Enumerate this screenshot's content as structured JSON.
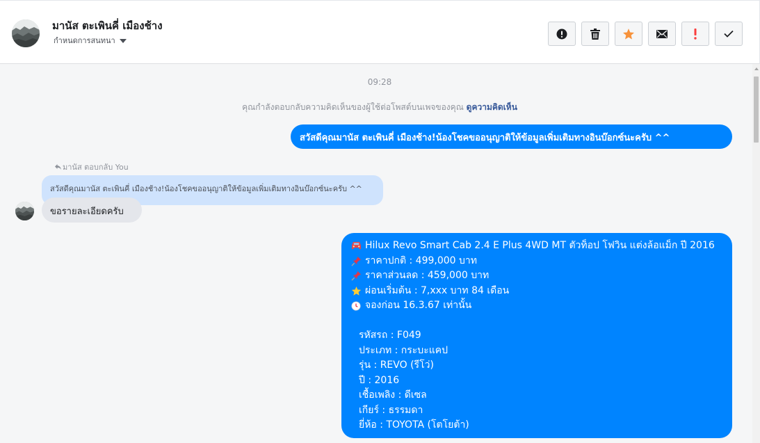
{
  "header": {
    "contact_name": "มานัส ตะเพินคี่ เมืองช้าง",
    "assign_label": "กำหนดการสนทนา",
    "actions": [
      {
        "name": "report-spam-button",
        "icon": "exclamation-circle-icon"
      },
      {
        "name": "delete-button",
        "icon": "trash-icon"
      },
      {
        "name": "star-button",
        "icon": "star-icon",
        "color": "#f7923b"
      },
      {
        "name": "mark-unread-button",
        "icon": "envelope-icon"
      },
      {
        "name": "follow-up-button",
        "icon": "exclamation-icon",
        "color": "#fa3e3e"
      },
      {
        "name": "mark-done-button",
        "icon": "checkmark-icon"
      }
    ]
  },
  "thread": {
    "time": "09:28",
    "notice_text": "คุณกำลังตอบกลับความคิดเห็นของผู้ใช้ต่อโพสต์บนเพจของคุณ ",
    "notice_link": "ดูความคิดเห็น",
    "outgoing_message_1": "สวัสดีคุณมานัส ตะเพินคี่ เมืองช้าง!น้องโชคขออนุญาติให้ข้อมูลเพิ่มเติมทางอินบ๊อกซ์นะครับ ^^",
    "reply_header": "มานัส ตอบกลับ You",
    "quoted_message": "สวัสดีคุณมานัส ตะเพินคี่ เมืองช้าง!น้องโชคขออนุญาติให้ข้อมูลเพิ่มเติมทางอินบ๊อกซ์นะครับ ^^",
    "incoming_message": "ขอรายละเอียดครับ",
    "listing": {
      "title": "Hilux Revo Smart Cab 2.4 E Plus 4WD MT ตัวท็อป โฟวิน แต่งล้อแม็ก ปี 2016",
      "normal_price": "ราคาปกติ : 499,000 บาท",
      "discount_price": "ราคาส่วนลด : 459,000 บาท",
      "installment": "ผ่อนเริ่มต้น : 7,xxx บาท 84 เดือน",
      "deposit": "จองก่อน 16.3.67 เท่านั้น",
      "details": [
        "รหัสรถ : F049",
        "ประเภท : กระบะแคป",
        "รุ่น : REVO (รีโว่)",
        "ปี : 2016",
        "เชื้อเพลิง : ดีเซล",
        "เกียร์ : ธรรมดา",
        "ยี่ห้อ : TOYOTA (โตโยต้า)"
      ]
    }
  },
  "colors": {
    "outgoing_bubble": "#0084ff",
    "incoming_bubble": "#e4e6eb",
    "quoted_bubble": "#cfe3fd",
    "thread_bg": "#f5f6f7"
  }
}
